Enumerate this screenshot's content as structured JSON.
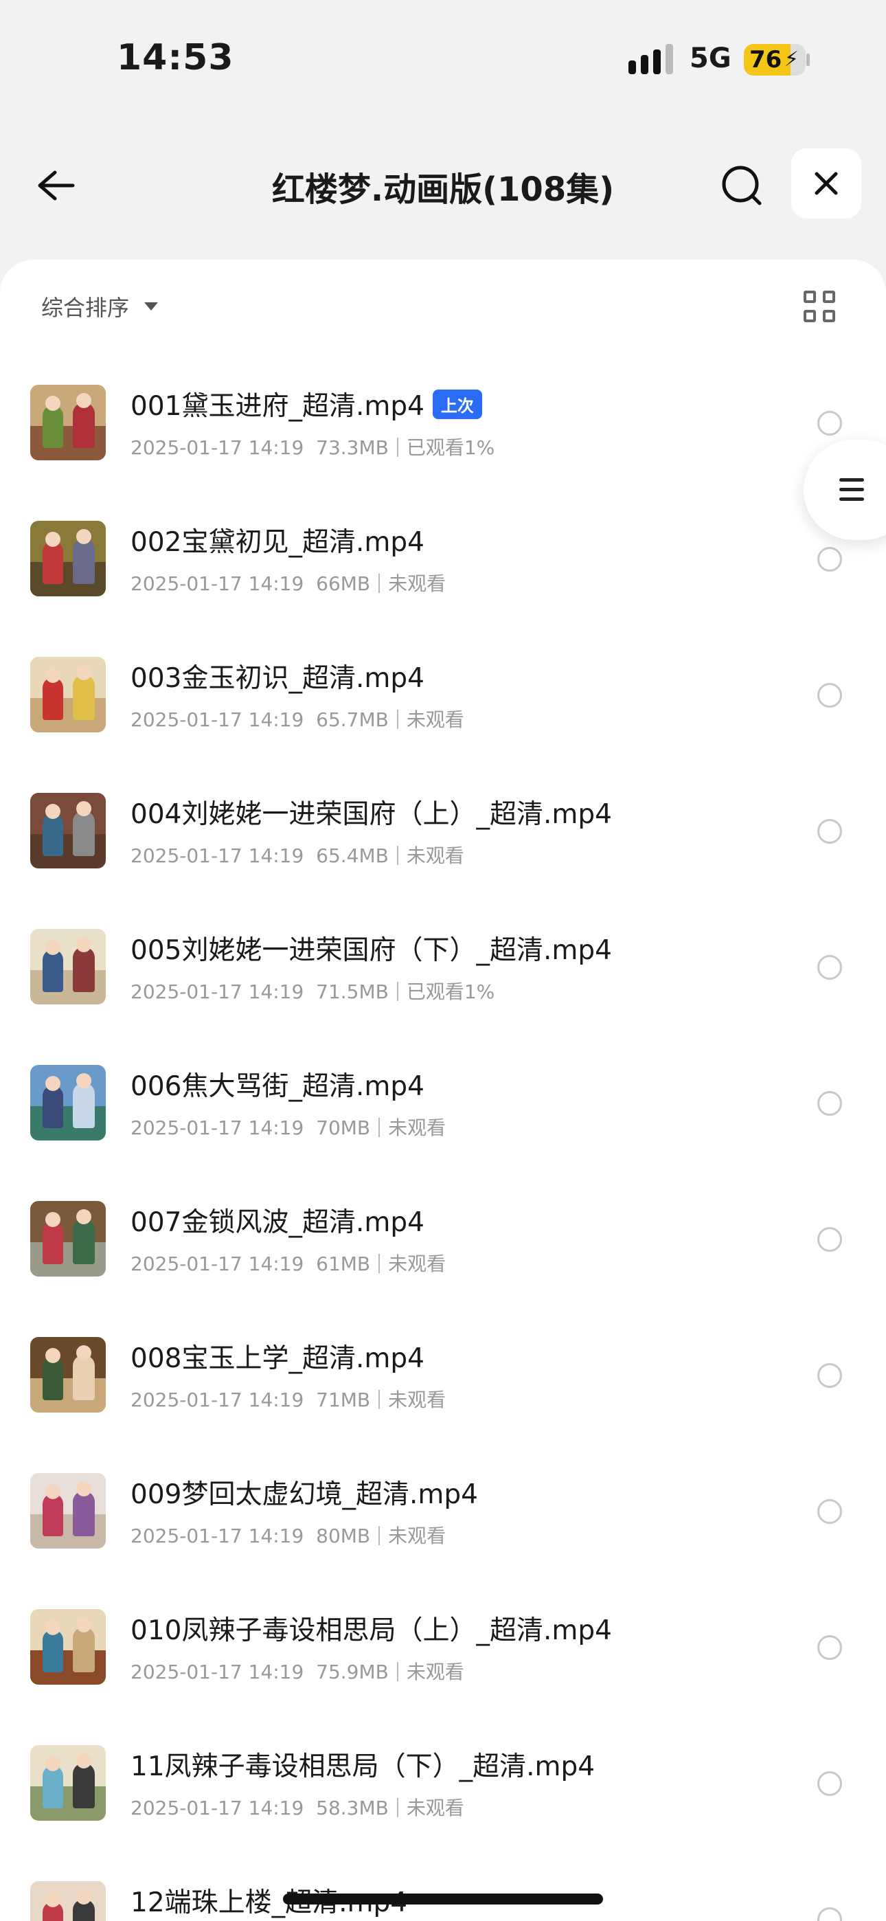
{
  "status_bar": {
    "time": "14:53",
    "network": "5G",
    "battery": "76",
    "battery_level": 0.76
  },
  "header": {
    "title": "红楼梦.动画版(108集)"
  },
  "icons": {
    "back": "back-arrow-icon",
    "search": "search-icon",
    "close": "close-icon",
    "sort": "caret-down-icon",
    "view": "grid-view-icon",
    "menu": "menu-icon"
  },
  "toolbar": {
    "sort_label": "综合排序"
  },
  "colors": {
    "accent": "#2a6cf6",
    "battery": "#f5c518",
    "panel": "#ffffff",
    "background": "#f2f2f4"
  },
  "items": [
    {
      "name": "001黛玉进府_超清.mp4",
      "tag": "上次",
      "date": "2025-01-17 14:19",
      "size": "73.3MB",
      "status": "已观看1%",
      "thumb": [
        "#c9a97a",
        "#8b5a3c",
        "#6a8f3a",
        "#b0303a"
      ]
    },
    {
      "name": "002宝黛初见_超清.mp4",
      "tag": "",
      "date": "2025-01-17 14:19",
      "size": "66MB",
      "status": "未观看",
      "thumb": [
        "#8a7a3a",
        "#5a4a2a",
        "#c03a3a",
        "#6a6a8a"
      ]
    },
    {
      "name": "003金玉初识_超清.mp4",
      "tag": "",
      "date": "2025-01-17 14:19",
      "size": "65.7MB",
      "status": "未观看",
      "thumb": [
        "#e8d8b8",
        "#c8a878",
        "#c8332e",
        "#e0c04a"
      ]
    },
    {
      "name": "004刘姥姥一进荣国府（上）_超清.mp4",
      "tag": "",
      "date": "2025-01-17 14:19",
      "size": "65.4MB",
      "status": "未观看",
      "thumb": [
        "#7a4a3a",
        "#5a3a2a",
        "#3a6a8a",
        "#8a8a8a"
      ]
    },
    {
      "name": "005刘姥姥一进荣国府（下）_超清.mp4",
      "tag": "",
      "date": "2025-01-17 14:19",
      "size": "71.5MB",
      "status": "已观看1%",
      "thumb": [
        "#e8e0c8",
        "#c8b898",
        "#3a5a8a",
        "#8a3a3a"
      ]
    },
    {
      "name": "006焦大骂街_超清.mp4",
      "tag": "",
      "date": "2025-01-17 14:19",
      "size": "70MB",
      "status": "未观看",
      "thumb": [
        "#6a9ac8",
        "#3a7a6a",
        "#3a4a7a",
        "#c8d8e8"
      ]
    },
    {
      "name": "007金锁风波_超清.mp4",
      "tag": "",
      "date": "2025-01-17 14:19",
      "size": "61MB",
      "status": "未观看",
      "thumb": [
        "#7a5a3a",
        "#9a9a8a",
        "#c03a4a",
        "#3a6a4a"
      ]
    },
    {
      "name": "008宝玉上学_超清.mp4",
      "tag": "",
      "date": "2025-01-17 14:19",
      "size": "71MB",
      "status": "未观看",
      "thumb": [
        "#6a4a2a",
        "#c8a878",
        "#3a5a3a",
        "#e8d0b0"
      ]
    },
    {
      "name": "009梦回太虚幻境_超清.mp4",
      "tag": "",
      "date": "2025-01-17 14:19",
      "size": "80MB",
      "status": "未观看",
      "thumb": [
        "#e8e0d8",
        "#c8b8a8",
        "#c03a5a",
        "#8a5a9a"
      ]
    },
    {
      "name": "010凤辣子毒设相思局（上）_超清.mp4",
      "tag": "",
      "date": "2025-01-17 14:19",
      "size": "75.9MB",
      "status": "未观看",
      "thumb": [
        "#e8d8b8",
        "#8a4a2a",
        "#3a7a9a",
        "#c8a878"
      ]
    },
    {
      "name": "11凤辣子毒设相思局（下）_超清.mp4",
      "tag": "",
      "date": "2025-01-17 14:19",
      "size": "58.3MB",
      "status": "未观看",
      "thumb": [
        "#e8e0c8",
        "#8a9a6a",
        "#6ab0c8",
        "#3a3a3a"
      ]
    },
    {
      "name": "12端珠上楼_超清.mp4",
      "tag": "",
      "date": "",
      "size": "",
      "status": "",
      "thumb": [
        "#e8d8c8",
        "#8a3a2a",
        "#c03a4a",
        "#3a3a3a"
      ]
    }
  ]
}
